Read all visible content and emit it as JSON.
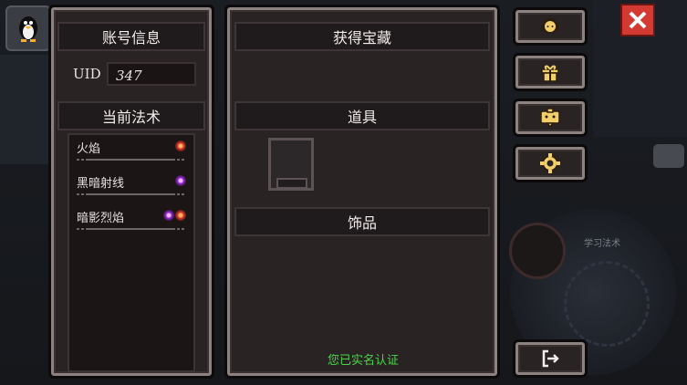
{
  "left_panel": {
    "account_title": "账号信息",
    "uid_label": "UID",
    "uid_value": "347",
    "spells_title": "当前法术",
    "spells": [
      {
        "label": "火焰",
        "icons": [
          "fire-icon"
        ]
      },
      {
        "label": "黑暗射线",
        "icons": [
          "dark-orb-icon"
        ]
      },
      {
        "label": "暗影烈焰",
        "icons": [
          "dark-orb-icon",
          "fire-icon"
        ]
      }
    ]
  },
  "middle_panel": {
    "treasure_title": "获得宝藏",
    "items_title": "道具",
    "accessories_title": "饰品",
    "verification_status": "您已实名认证"
  },
  "side_buttons": [
    {
      "name": "support-button",
      "icon": "headset-icon"
    },
    {
      "name": "gift-button",
      "icon": "gift-icon"
    },
    {
      "name": "chat-bubble-button",
      "icon": "chat-icon"
    },
    {
      "name": "settings-button",
      "icon": "gear-icon"
    },
    {
      "name": "logout-button",
      "icon": "logout-icon"
    }
  ],
  "background": {
    "spell_hint": "学习法术"
  },
  "colors": {
    "panel_border_light": "#8c8380",
    "panel_fill": "#2a2324",
    "verify_green": "#4bd44a",
    "close_red": "#d33a34"
  }
}
